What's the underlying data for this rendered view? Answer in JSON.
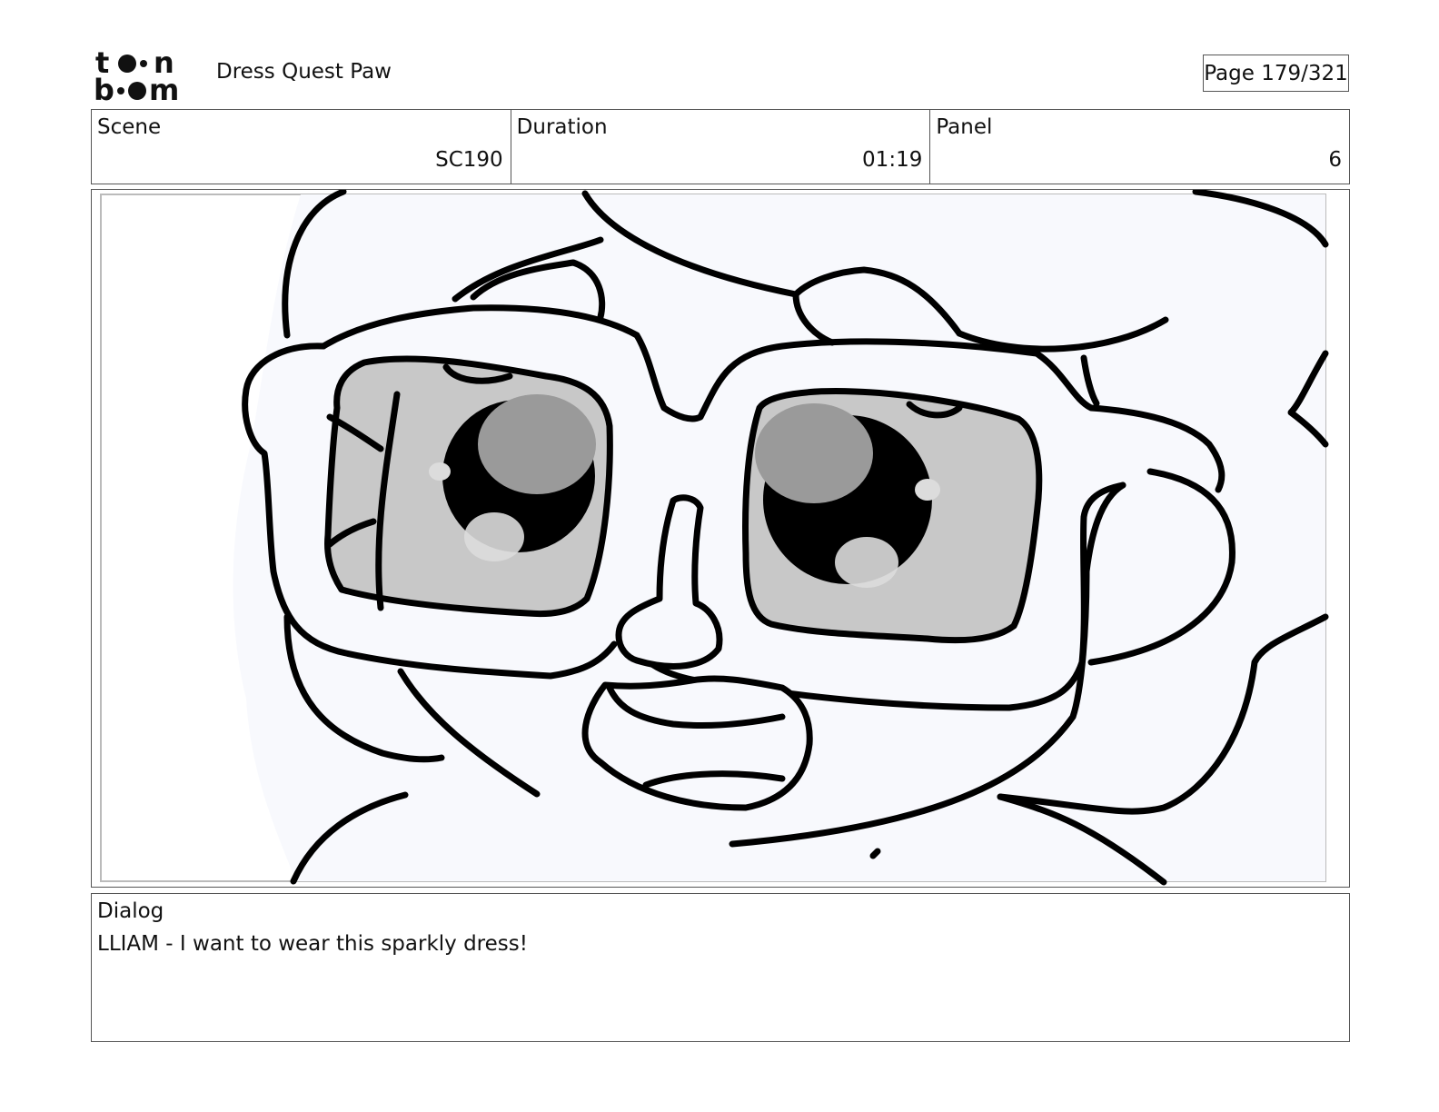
{
  "header": {
    "logo_text": "toonboom",
    "project_title": "Dress Quest Paw",
    "page_indicator": "Page 179/321"
  },
  "info": {
    "scene_label": "Scene",
    "scene_value": "SC190",
    "duration_label": "Duration",
    "duration_value": "01:19",
    "panel_label": "Panel",
    "panel_value": "6"
  },
  "dialog": {
    "label": "Dialog",
    "text": "LLIAM - I want to wear this sparkly dress!"
  },
  "artwork": {
    "line_color": "#000000",
    "skin_color": "#f8f9fd",
    "lens_color": "#c8c8c8",
    "eye_highlight_color": "#9a9a9a"
  }
}
